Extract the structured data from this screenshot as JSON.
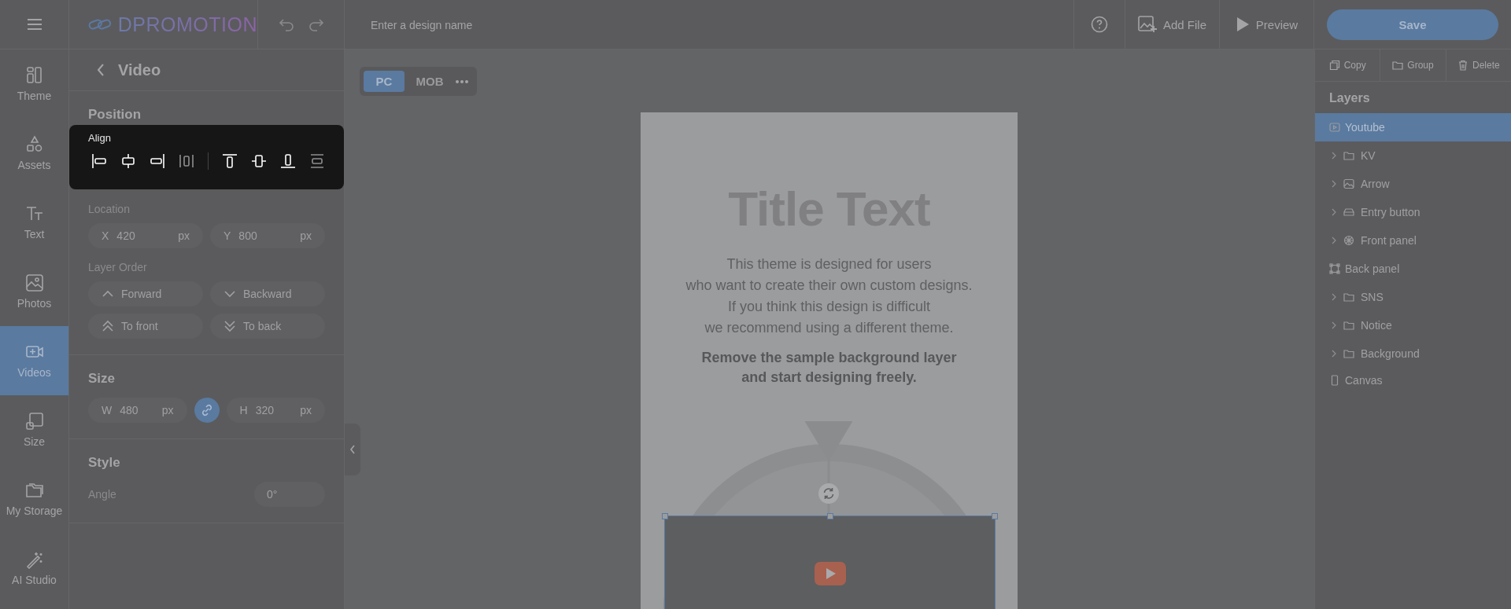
{
  "header": {
    "logo": "DPROMOTION",
    "design_name": {
      "placeholder": "Enter a design name"
    },
    "add_file": "Add File",
    "preview": "Preview",
    "save": "Save"
  },
  "nav": [
    {
      "label": "Theme",
      "selected": false
    },
    {
      "label": "Assets",
      "selected": false
    },
    {
      "label": "Text",
      "selected": false
    },
    {
      "label": "Photos",
      "selected": false
    },
    {
      "label": "Videos",
      "selected": true
    },
    {
      "label": "Size",
      "selected": false
    },
    {
      "label": "My Storage",
      "selected": false
    },
    {
      "label": "AI Studio",
      "selected": false
    }
  ],
  "panel": {
    "title": "Video",
    "position": {
      "title": "Position",
      "align_label": "Align",
      "location_label": "Location",
      "x": {
        "prefix": "X",
        "value": "420",
        "unit": "px"
      },
      "y": {
        "prefix": "Y",
        "value": "800",
        "unit": "px"
      },
      "layer_order_label": "Layer Order",
      "layer_order": [
        {
          "label": "Forward",
          "kind": "up"
        },
        {
          "label": "Backward",
          "kind": "down"
        },
        {
          "label": "To front",
          "kind": "top"
        },
        {
          "label": "To back",
          "kind": "bottom"
        }
      ]
    },
    "size": {
      "title": "Size",
      "w": {
        "prefix": "W",
        "value": "480",
        "unit": "px"
      },
      "h": {
        "prefix": "H",
        "value": "320",
        "unit": "px"
      },
      "linked": true
    },
    "style": {
      "title": "Style",
      "angle_label": "Angle",
      "angle": "0°"
    }
  },
  "canvas": {
    "views": [
      {
        "label": "PC",
        "selected": true
      },
      {
        "label": "MOB",
        "selected": false
      }
    ],
    "page": {
      "title": "Title Text",
      "paragraph": [
        "This theme is designed for users",
        "who want to create their own custom designs.",
        "If you think this design is difficult",
        "we recommend using a different theme."
      ],
      "bold_lines": [
        "Remove the sample background layer",
        "and start designing freely."
      ]
    }
  },
  "layer_actions": [
    "Copy",
    "Group",
    "Delete"
  ],
  "layers": {
    "title": "Layers",
    "items": [
      {
        "label": "Youtube",
        "kind": "video",
        "collapsible": false,
        "selected": true
      },
      {
        "label": "KV",
        "kind": "folder",
        "collapsible": true,
        "selected": false
      },
      {
        "label": "Arrow",
        "kind": "image",
        "collapsible": true,
        "selected": false
      },
      {
        "label": "Entry button",
        "kind": "button",
        "collapsible": true,
        "selected": false
      },
      {
        "label": "Front panel",
        "kind": "panel",
        "collapsible": true,
        "selected": false
      },
      {
        "label": "Back panel",
        "kind": "frame",
        "collapsible": false,
        "selected": false
      },
      {
        "label": "SNS",
        "kind": "folder",
        "collapsible": true,
        "selected": false
      },
      {
        "label": "Notice",
        "kind": "folder",
        "collapsible": true,
        "selected": false
      },
      {
        "label": "Background",
        "kind": "folder",
        "collapsible": true,
        "selected": false
      },
      {
        "label": "Canvas",
        "kind": "canvas",
        "collapsible": false,
        "selected": false
      }
    ]
  }
}
